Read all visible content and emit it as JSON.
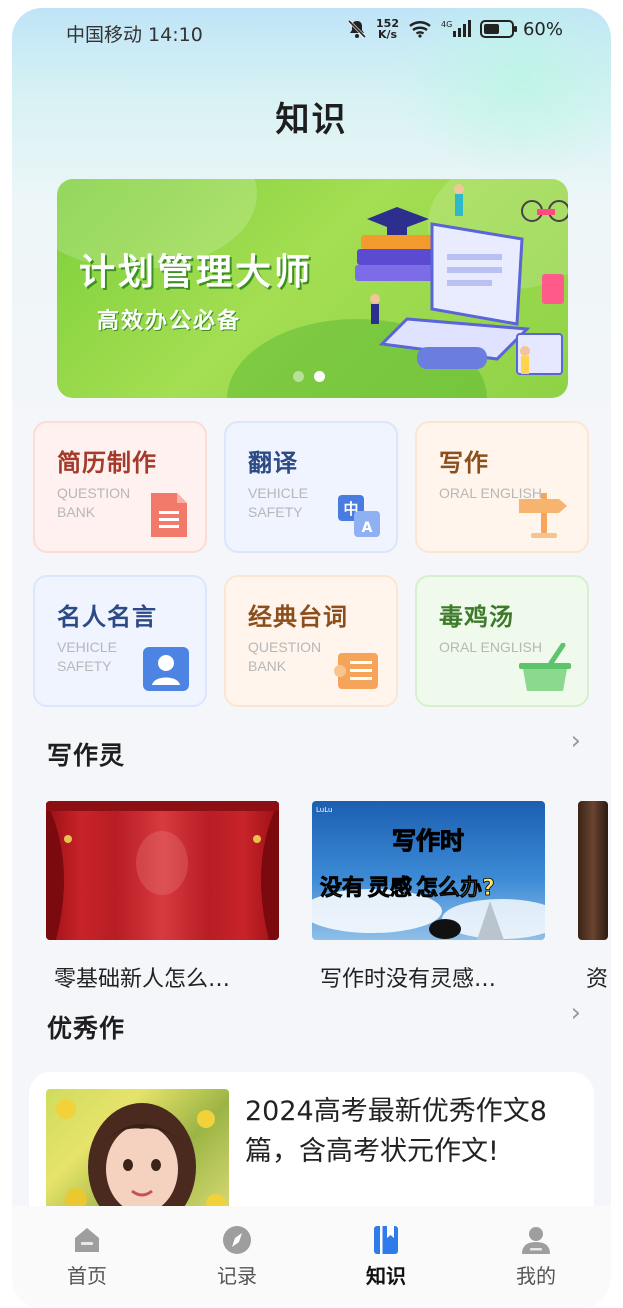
{
  "status_bar": {
    "carrier_time": "中国移动 14:10",
    "speed_value": "152",
    "speed_unit": "K/s",
    "network": "4G",
    "battery": "60%"
  },
  "header": {
    "title": "知识"
  },
  "banner": {
    "title": "计划管理大师",
    "subtitle": "高效办公必备",
    "page_count": 2,
    "active_page": 2
  },
  "categories": [
    {
      "title": "简历制作",
      "subtitle": "QUESTION BANK",
      "icon": "document-icon"
    },
    {
      "title": "翻译",
      "subtitle": "VEHICLE SAFETY",
      "icon": "translate-icon",
      "icon_text_1": "中",
      "icon_text_2": "A"
    },
    {
      "title": "写作",
      "subtitle": "ORAL ENGLISH",
      "icon": "signpost-icon"
    },
    {
      "title": "名人名言",
      "subtitle": "VEHICLE SAFETY",
      "icon": "person-icon"
    },
    {
      "title": "经典台词",
      "subtitle": "QUESTION BANK",
      "icon": "scroll-icon"
    },
    {
      "title": "毒鸡汤",
      "subtitle": "ORAL ENGLISH",
      "icon": "bowl-icon"
    }
  ],
  "writing_section": {
    "title": "写作灵",
    "items": [
      {
        "caption": "零基础新人怎么…"
      },
      {
        "caption": "写作时没有灵感…",
        "thumb_line1": "写作时",
        "thumb_line2a": "没有",
        "thumb_line2b": "灵感",
        "thumb_line2c": "怎么办?",
        "thumb_brand": "LuLu"
      },
      {
        "caption": "资"
      }
    ]
  },
  "excellent_section": {
    "title": "优秀作",
    "article": {
      "title": "2024高考最新优秀作文8篇，含高考状元作文!"
    }
  },
  "tabs": [
    {
      "label": "首页",
      "icon": "home-icon"
    },
    {
      "label": "记录",
      "icon": "compass-icon"
    },
    {
      "label": "知识",
      "icon": "book-icon",
      "active": true
    },
    {
      "label": "我的",
      "icon": "profile-icon"
    }
  ],
  "colors": {
    "accent": "#2f7bea",
    "banner_green": "#8fd246"
  }
}
